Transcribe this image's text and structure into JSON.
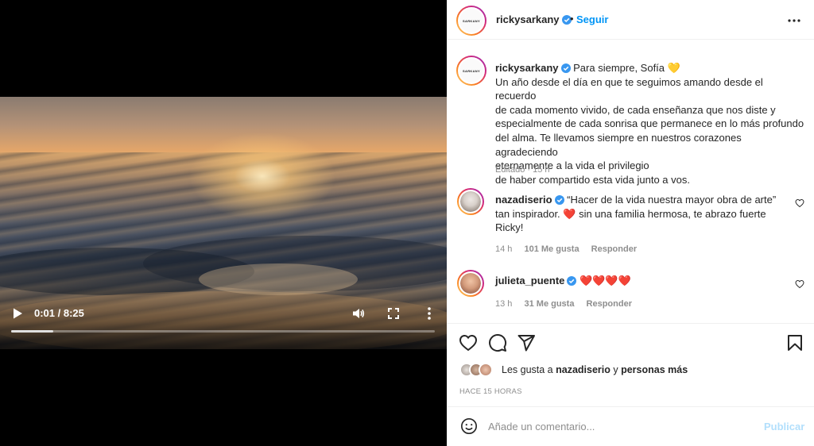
{
  "video": {
    "time": "0:01 / 8:25",
    "progress": 0.1
  },
  "post": {
    "username": "rickysarkany",
    "avatar_logo_text": "SARKANY",
    "follow_label": "Seguir",
    "separator": "•",
    "caption_title": "Para siempre, Sofía 💛",
    "caption_lines": [
      "Un año desde el día en que te seguimos amando desde el recuerdo",
      "de cada momento vivido, de cada enseñanza que nos diste y",
      "especialmente de cada sonrisa que permanece en lo más profundo",
      "del alma. Te llevamos siempre en nuestros corazones agradeciendo",
      "eternamente a la vida el privilegio",
      "de haber compartido esta vida junto a vos."
    ],
    "caption_meta": "Editado · 15 h"
  },
  "comments": [
    {
      "username": "nazadiserio",
      "text_line1": "“Hacer de la vida nuestra mayor obra de arte”",
      "text_line2": "tan inspirador. ❤️ sin una familia hermosa, te abrazo fuerte",
      "text_line3": "Ricky!",
      "time": "14 h",
      "likes": "101 Me gusta",
      "reply": "Responder"
    },
    {
      "username": "julieta_puente",
      "text_line1": "❤️❤️❤️❤️",
      "time": "13 h",
      "likes": "31 Me gusta",
      "reply": "Responder"
    }
  ],
  "likes_summary": {
    "prefix": "Les gusta a ",
    "user": "nazadiserio",
    "middle": " y ",
    "others": "personas más"
  },
  "time_ago": "HACE 15 HORAS",
  "add_comment": {
    "placeholder": "Añade un comentario...",
    "publish_label": "Publicar"
  },
  "colors": {
    "accent": "#0095f6",
    "verified": "#3897f0",
    "publish_disabled": "#b2dffc"
  }
}
